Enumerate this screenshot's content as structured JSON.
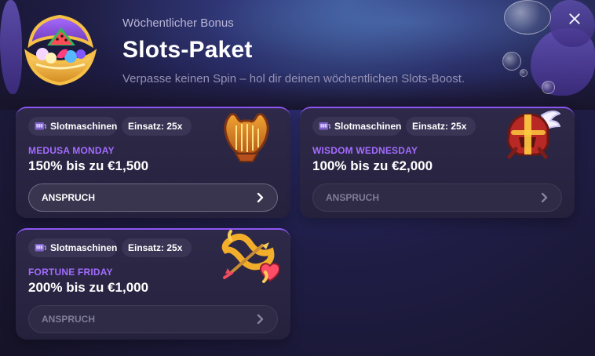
{
  "header": {
    "eyebrow": "Wöchentlicher Bonus",
    "title": "Slots-Paket",
    "subtitle": "Verpasse keinen Spin – hol dir deinen wöchentlichen Slots-Boost."
  },
  "cards": [
    {
      "tags": [
        "Slotmaschinen",
        "Einsatz: 25x"
      ],
      "name": "MEDUSA MONDAY",
      "offer": "150% bis zu €1,500",
      "button_label": "ANSPRUCH",
      "button_state": "active",
      "icon": "harp-icon"
    },
    {
      "tags": [
        "Slotmaschinen",
        "Einsatz: 25x"
      ],
      "name": "WISDOM WEDNESDAY",
      "offer": "100% bis zu €2,000",
      "button_label": "ANSPRUCH",
      "button_state": "disabled",
      "icon": "winged-helmet-icon"
    },
    {
      "tags": [
        "Slotmaschinen",
        "Einsatz: 25x"
      ],
      "name": "FORTUNE FRIDAY",
      "offer": "200% bis zu €1,000",
      "button_label": "ANSPRUCH",
      "button_state": "disabled",
      "icon": "bow-and-arrow-icon"
    }
  ],
  "icons": {
    "hero": "treasure-chest-icon",
    "close": "close-icon",
    "tag": "slot-machine-icon",
    "button": "chevron-right-icon"
  },
  "colors": {
    "accent": "#8d56f4",
    "promo_title": "#a36cff",
    "text": "#ffffff",
    "muted": "#9592b7",
    "card": "#2e2948",
    "button": "#39354f",
    "background": "#171327"
  }
}
